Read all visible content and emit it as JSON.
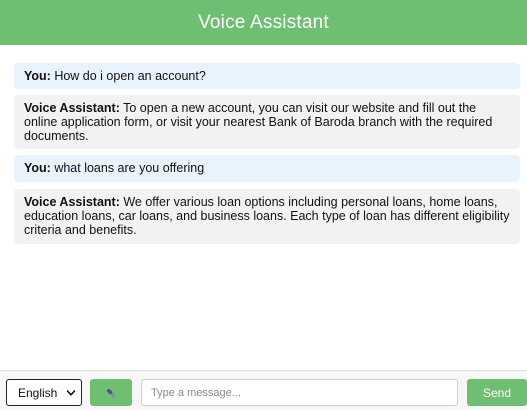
{
  "header": {
    "title": "Voice Assistant"
  },
  "messages": [
    {
      "role": "user",
      "speaker": "You:",
      "text": " How do i open an account?"
    },
    {
      "role": "assistant",
      "speaker": "Voice Assistant:",
      "text": " To open a new account, you can visit our website and fill out the online application form, or visit your nearest Bank of Baroda branch with the required documents."
    },
    {
      "role": "user",
      "speaker": "You:",
      "text": " what loans are you offering"
    },
    {
      "role": "assistant",
      "speaker": "Voice Assistant:",
      "text": " We offer various loan options including personal loans, home loans, education loans, car loans, and business loans. Each type of loan has different eligibility criteria and benefits."
    }
  ],
  "footer": {
    "language": {
      "selected": "English"
    },
    "mic_icon": "microphone-icon",
    "input": {
      "placeholder": "Type a message...",
      "value": ""
    },
    "send_label": "Send"
  },
  "colors": {
    "accent": "#6fbf73",
    "user_bubble": "#e9f3fd",
    "assistant_bubble": "#f2f2f2"
  }
}
